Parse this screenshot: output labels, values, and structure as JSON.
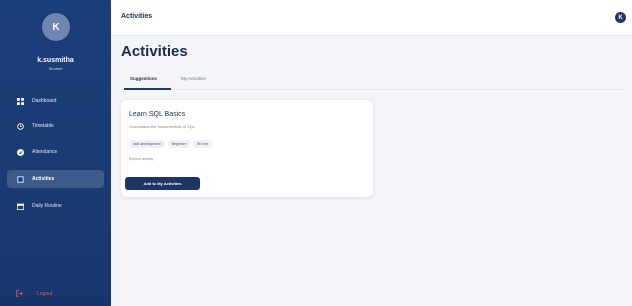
{
  "user": {
    "initial": "K",
    "name": "k.susmitha",
    "role": "Student"
  },
  "sidebar": {
    "items": [
      {
        "label": "Dashboard",
        "icon": "grid-icon"
      },
      {
        "label": "Timetable",
        "icon": "clock-icon"
      },
      {
        "label": "Attendance",
        "icon": "check-circle-icon"
      },
      {
        "label": "Activities",
        "icon": "activity-icon",
        "active": true
      },
      {
        "label": "Daily Routine",
        "icon": "calendar-icon"
      }
    ],
    "logout_label": "Logout"
  },
  "topbar": {
    "title": "Activities",
    "notification_initial": "K"
  },
  "page": {
    "title": "Activities"
  },
  "tabs": [
    {
      "label": "Suggestions",
      "active": true
    },
    {
      "label": "My Activities",
      "active": false
    }
  ],
  "card": {
    "title": "Learn SQL Basics",
    "description": "Understand the fundamentals of SQL",
    "tags": [
      "skill development",
      "Beginner",
      "90 min"
    ],
    "link": "Explore activity",
    "button": "Add to My Activities"
  },
  "colors": {
    "sidebar": "#1b3f7a",
    "accent": "#1e3663",
    "logout": "#ef5a5a",
    "background": "#f4f5f8"
  }
}
